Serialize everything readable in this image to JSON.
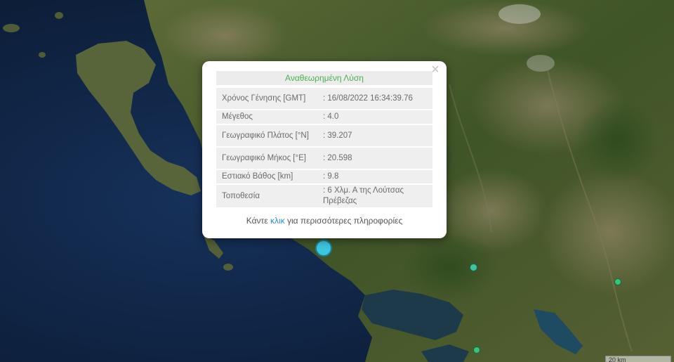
{
  "popup": {
    "title": "Αναθεωρημένη Λύση",
    "close_label": "×",
    "rows": [
      {
        "label": "Χρόνος Γένησης [GMT]",
        "value": ": 16/08/2022 16:34:39.76"
      },
      {
        "label": "Μέγεθος",
        "value": ": 4.0"
      },
      {
        "label": "Γεωγραφικό Πλάτος [°N]",
        "value": ": 39.207"
      },
      {
        "label": "Γεωγραφικό Μήκος [°E]",
        "value": ": 20.598"
      },
      {
        "label": "Εστιακό Βάθος [km]",
        "value": ": 9.8"
      },
      {
        "label": "Τοποθεσία",
        "value": ": 6 Χλμ. Α της Λούτσας Πρέβεζας"
      }
    ],
    "more_prefix": "Κάντε ",
    "more_link": "κλικ",
    "more_suffix": " για περισσότερες πληροφορίες"
  },
  "markers": [
    {
      "id": "main",
      "color": "#3cc6e0"
    },
    {
      "id": "m2",
      "color": "#3cc6a0"
    },
    {
      "id": "m3",
      "color": "#35c47a"
    },
    {
      "id": "m4",
      "color": "#35c47a"
    }
  ],
  "scale_label": "20 km",
  "colors": {
    "sea": "#10233f",
    "land": "#4a5a2c",
    "title_green": "#4caf50",
    "link": "#2a8fd1"
  }
}
